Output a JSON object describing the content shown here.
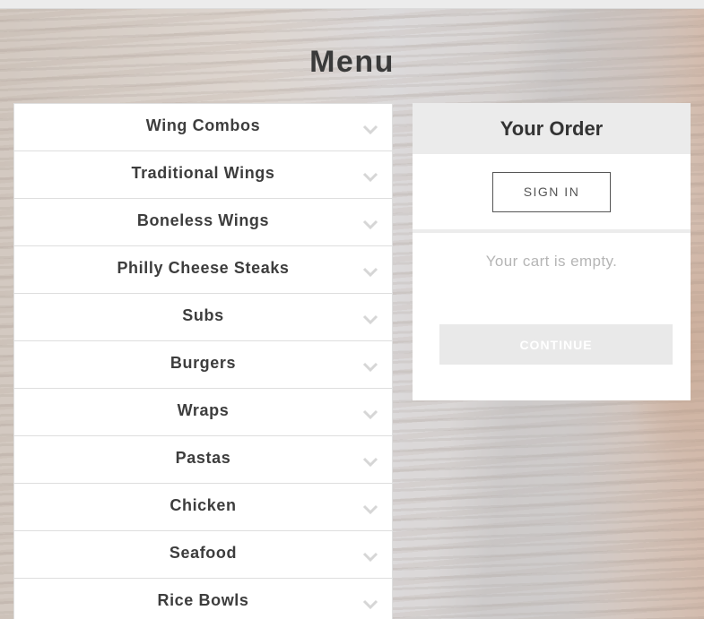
{
  "page": {
    "title": "Menu"
  },
  "menu": {
    "categories": [
      {
        "label": "Wing Combos"
      },
      {
        "label": "Traditional Wings"
      },
      {
        "label": "Boneless Wings"
      },
      {
        "label": "Philly Cheese Steaks"
      },
      {
        "label": "Subs"
      },
      {
        "label": "Burgers"
      },
      {
        "label": "Wraps"
      },
      {
        "label": "Pastas"
      },
      {
        "label": "Chicken"
      },
      {
        "label": "Seafood"
      },
      {
        "label": "Rice Bowls"
      }
    ],
    "expand_icon": "chevron-down-icon"
  },
  "order": {
    "title": "Your Order",
    "sign_in_label": "SIGN IN",
    "empty_message": "Your cart is empty.",
    "continue_label": "CONTINUE"
  },
  "colors": {
    "heading_text": "#3a3a3a",
    "chevron": "#d6d6d6",
    "order_header_bg": "#ebebeb",
    "disabled_button_bg": "#e9e9e9"
  }
}
